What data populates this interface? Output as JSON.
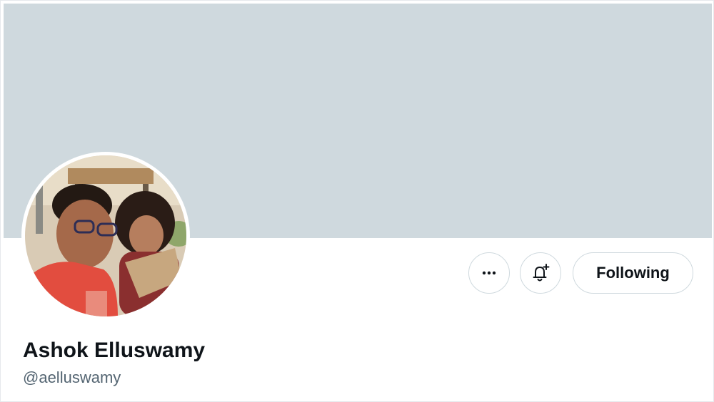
{
  "profile": {
    "display_name": "Ashok Elluswamy",
    "handle": "@aelluswamy"
  },
  "actions": {
    "more_icon": "more-horizontal-icon",
    "notify_icon": "bell-plus-icon",
    "follow_label": "Following"
  },
  "colors": {
    "banner": "#cfd9de",
    "text_primary": "#0f1419",
    "text_secondary": "#536471",
    "button_border": "#cfd9de"
  }
}
